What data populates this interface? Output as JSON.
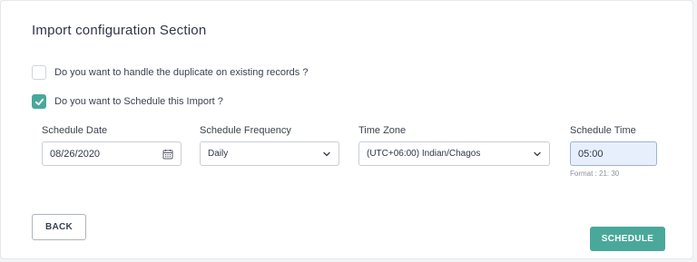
{
  "section": {
    "title": "Import configuration Section"
  },
  "options": {
    "duplicate": {
      "label": "Do you want to handle the duplicate on existing records ?",
      "checked": false
    },
    "schedule": {
      "label": "Do you want to Schedule this Import ?",
      "checked": true
    }
  },
  "fields": {
    "schedule_date": {
      "label": "Schedule Date",
      "value": "08/26/2020",
      "icon": "calendar-icon"
    },
    "schedule_frequency": {
      "label": "Schedule Frequency",
      "value": "Daily",
      "icon": "chevron-down-icon"
    },
    "time_zone": {
      "label": "Time Zone",
      "value": "(UTC+06:00) Indian/Chagos",
      "icon": "chevron-down-icon"
    },
    "schedule_time": {
      "label": "Schedule Time",
      "value": "05:00",
      "hint": "Format : 21: 30"
    }
  },
  "buttons": {
    "back": "BACK",
    "schedule": "SCHEDULE"
  },
  "colors": {
    "accent": "#4aa89a",
    "time_input_bg": "#e8effc"
  }
}
